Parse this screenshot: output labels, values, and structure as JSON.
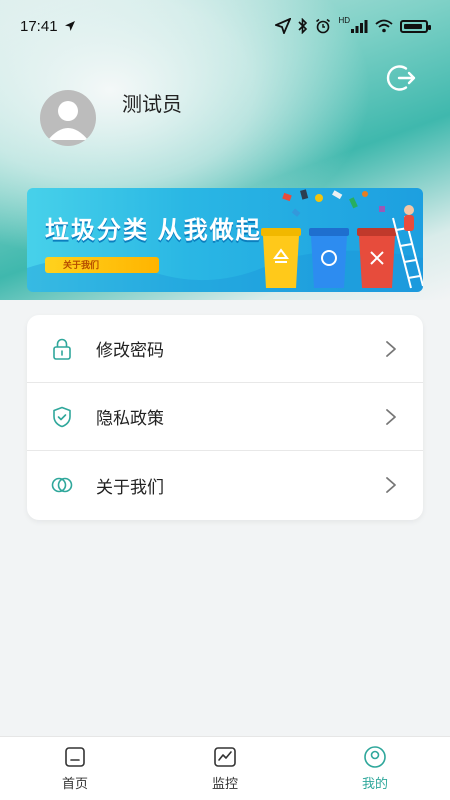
{
  "status_bar": {
    "time": "17:41",
    "network_badge": "HD"
  },
  "profile": {
    "username": "测试员"
  },
  "banner": {
    "title": "垃圾分类 从我做起",
    "button_label": "关于我们"
  },
  "menu": {
    "items": [
      {
        "label": "修改密码",
        "icon": "lock-icon"
      },
      {
        "label": "隐私政策",
        "icon": "shield-icon"
      },
      {
        "label": "关于我们",
        "icon": "overlap-circles-icon"
      }
    ]
  },
  "tabbar": {
    "tabs": [
      {
        "label": "首页",
        "icon": "home-icon"
      },
      {
        "label": "监控",
        "icon": "monitor-chart-icon"
      },
      {
        "label": "我的",
        "icon": "user-icon",
        "active": true
      }
    ]
  },
  "colors": {
    "accent": "#2fa79b",
    "header_teal": "#3fb8ad",
    "banner_blue": "#1d9fe0"
  }
}
